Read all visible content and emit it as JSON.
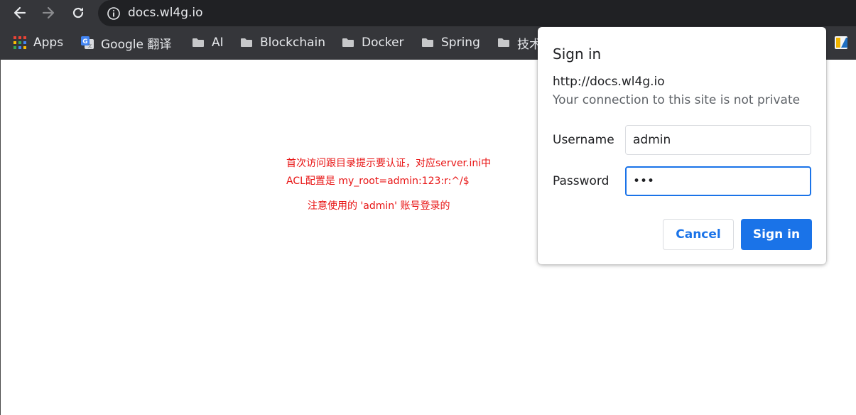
{
  "browser": {
    "url": "docs.wl4g.io",
    "nav": {
      "back_icon": "arrow-left",
      "forward_icon": "arrow-right",
      "reload_icon": "reload"
    },
    "bookmarks": [
      {
        "label": "Apps",
        "icon": "apps-grid-icon"
      },
      {
        "label": "Google 翻译",
        "icon": "google-translate-icon"
      },
      {
        "label": "AI",
        "icon": "folder-icon"
      },
      {
        "label": "Blockchain",
        "icon": "folder-icon"
      },
      {
        "label": "Docker",
        "icon": "folder-icon"
      },
      {
        "label": "Spring",
        "icon": "folder-icon"
      },
      {
        "label": "技术",
        "icon": "folder-icon"
      }
    ]
  },
  "page": {
    "notes": [
      "首次访问跟目录提示要认证，对应server.ini中",
      "ACL配置是 my_root=admin:123:r:^/$",
      "注意使用的 'admin' 账号登录的"
    ],
    "note_color": "#e81414"
  },
  "dialog": {
    "title": "Sign in",
    "origin": "http://docs.wl4g.io",
    "warning": "Your connection to this site is not private",
    "username_label": "Username",
    "username_value": "admin",
    "password_label": "Password",
    "password_value": "•••",
    "cancel_label": "Cancel",
    "signin_label": "Sign in",
    "accent_color": "#1a73e8"
  }
}
